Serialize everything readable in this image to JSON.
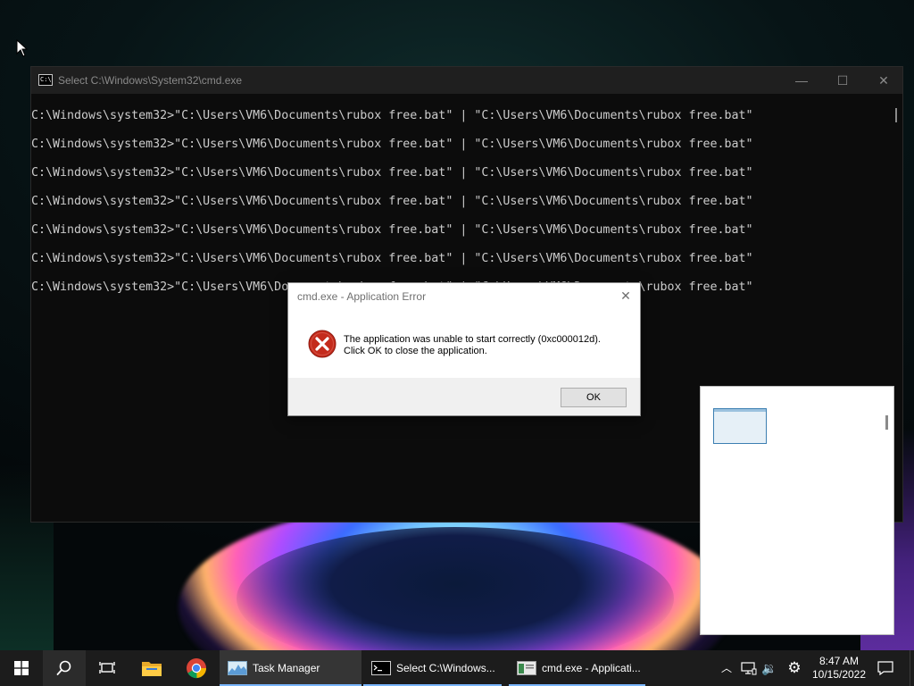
{
  "cmd_window": {
    "title": "Select C:\\Windows\\System32\\cmd.exe",
    "icon_text": "C:\\",
    "controls": {
      "minimize": "—",
      "maximize": "☐",
      "close": "✕"
    },
    "lines": [
      "C:\\Windows\\system32>\"C:\\Users\\VM6\\Documents\\rubox free.bat\" | \"C:\\Users\\VM6\\Documents\\rubox free.bat\"",
      "C:\\Windows\\system32>\"C:\\Users\\VM6\\Documents\\rubox free.bat\" | \"C:\\Users\\VM6\\Documents\\rubox free.bat\"",
      "C:\\Windows\\system32>\"C:\\Users\\VM6\\Documents\\rubox free.bat\" | \"C:\\Users\\VM6\\Documents\\rubox free.bat\"",
      "C:\\Windows\\system32>\"C:\\Users\\VM6\\Documents\\rubox free.bat\" | \"C:\\Users\\VM6\\Documents\\rubox free.bat\"",
      "C:\\Windows\\system32>\"C:\\Users\\VM6\\Documents\\rubox free.bat\" | \"C:\\Users\\VM6\\Documents\\rubox free.bat\"",
      "C:\\Windows\\system32>\"C:\\Users\\VM6\\Documents\\rubox free.bat\" | \"C:\\Users\\VM6\\Documents\\rubox free.bat\"",
      "C:\\Windows\\system32>\"C:\\Users\\VM6\\Documents\\rubox free.bat\" | \"C:\\Users\\VM6\\Documents\\rubox free.bat\""
    ]
  },
  "error_dialog": {
    "title": "cmd.exe - Application Error",
    "close": "✕",
    "message_line1": "The application was unable to start correctly (0xc000012d).",
    "message_line2": "Click OK to close the application.",
    "ok_label": "OK"
  },
  "taskbar": {
    "apps": [
      {
        "label": "Task Manager"
      },
      {
        "label": "Select C:\\Windows..."
      },
      {
        "label": "cmd.exe - Applicati..."
      }
    ],
    "tray_up": "︿",
    "volume": "🔉",
    "settings": "⚙",
    "clock_time": "8:47 AM",
    "clock_date": "10/15/2022"
  },
  "colors": {
    "taskbar_bg": "#1c1c1c",
    "active_underline": "#7ab6ff",
    "error_red": "#c42b1c",
    "cmd_bg": "#0c0c0c",
    "cmd_text": "#cccccc"
  }
}
